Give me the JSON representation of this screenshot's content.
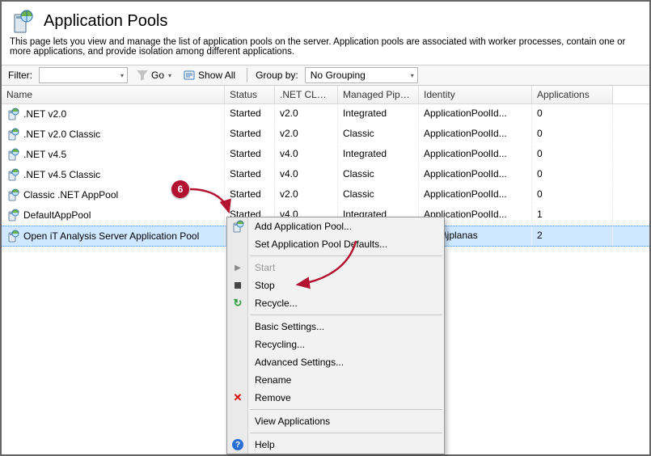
{
  "header": {
    "title": "Application Pools",
    "description": "This page lets you view and manage the list of application pools on the server. Application pools are associated with worker processes, contain one or more applications, and provide isolation among different applications."
  },
  "toolbar": {
    "filter_label": "Filter:",
    "filter_value": "",
    "go_label": "Go",
    "show_all_label": "Show All",
    "group_by_label": "Group by:",
    "group_by_value": "No Grouping"
  },
  "columns": [
    "Name",
    "Status",
    ".NET CLR V...",
    "Managed Pipel...",
    "Identity",
    "Applications"
  ],
  "rows": [
    {
      "name": ".NET v2.0",
      "status": "Started",
      "clr": "v2.0",
      "pipe": "Integrated",
      "identity": "ApplicationPoolId...",
      "apps": "0"
    },
    {
      "name": ".NET v2.0 Classic",
      "status": "Started",
      "clr": "v2.0",
      "pipe": "Classic",
      "identity": "ApplicationPoolId...",
      "apps": "0"
    },
    {
      "name": ".NET v4.5",
      "status": "Started",
      "clr": "v4.0",
      "pipe": "Integrated",
      "identity": "ApplicationPoolId...",
      "apps": "0"
    },
    {
      "name": ".NET v4.5 Classic",
      "status": "Started",
      "clr": "v4.0",
      "pipe": "Classic",
      "identity": "ApplicationPoolId...",
      "apps": "0"
    },
    {
      "name": "Classic .NET AppPool",
      "status": "Started",
      "clr": "v2.0",
      "pipe": "Classic",
      "identity": "ApplicationPoolId...",
      "apps": "0"
    },
    {
      "name": "DefaultAppPool",
      "status": "Started",
      "clr": "v4.0",
      "pipe": "Integrated",
      "identity": "ApplicationPoolId...",
      "apps": "1"
    },
    {
      "name": "Open iT Analysis Server Application Pool",
      "status": "",
      "clr": "",
      "pipe": "",
      "identity": "SVG\\jplanas",
      "apps": "2",
      "selected": true
    }
  ],
  "context_menu": {
    "items": [
      {
        "label": "Add Application Pool...",
        "icon": "add-pool-icon"
      },
      {
        "label": "Set Application Pool Defaults..."
      },
      "sep",
      {
        "label": "Start",
        "icon": "play-icon",
        "disabled": true
      },
      {
        "label": "Stop",
        "icon": "stop-icon"
      },
      {
        "label": "Recycle...",
        "icon": "recycle-icon"
      },
      "sep",
      {
        "label": "Basic Settings..."
      },
      {
        "label": "Recycling..."
      },
      {
        "label": "Advanced Settings..."
      },
      {
        "label": "Rename"
      },
      {
        "label": "Remove",
        "icon": "remove-icon"
      },
      "sep",
      {
        "label": "View Applications"
      },
      "sep",
      {
        "label": "Help",
        "icon": "help-icon"
      }
    ]
  },
  "annotation": {
    "badge": "6"
  }
}
